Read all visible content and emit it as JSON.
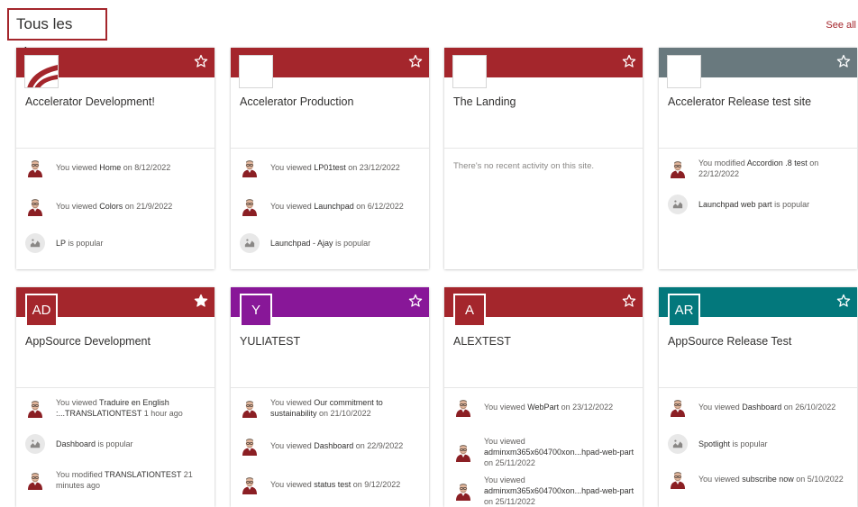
{
  "page": {
    "title": "Tous les sites",
    "see_all": "See all"
  },
  "colors": {
    "red": "#a4262c",
    "grey": "#69797e",
    "purple": "#881798",
    "teal": "#03787c",
    "link": "#a4262c"
  },
  "cards": [
    {
      "name": "Accelerator Development!",
      "banner": "#a4262c",
      "logo": "acr-logo-icon",
      "favorite": false,
      "activities": [
        {
          "type": "viewed",
          "prefix": "You viewed ",
          "bold": "Home",
          "suffix": " on 8/12/2022"
        },
        {
          "type": "viewed",
          "prefix": "You viewed ",
          "bold": "Colors",
          "suffix": " on 21/9/2022"
        },
        {
          "type": "popular",
          "prefix": "",
          "bold": "LP",
          "suffix": " is popular"
        }
      ]
    },
    {
      "name": "Accelerator Production",
      "banner": "#a4262c",
      "logo": "blank",
      "favorite": false,
      "activities": [
        {
          "type": "viewed",
          "prefix": "You viewed ",
          "bold": "LP01test",
          "suffix": " on 23/12/2022"
        },
        {
          "type": "viewed",
          "prefix": "You viewed ",
          "bold": "Launchpad",
          "suffix": " on 6/12/2022"
        },
        {
          "type": "popular",
          "prefix": "",
          "bold": "Launchpad - Ajay",
          "suffix": " is popular"
        }
      ]
    },
    {
      "name": "The Landing",
      "banner": "#a4262c",
      "logo": "blank",
      "favorite": false,
      "empty_message": "There's no recent activity on this site.",
      "activities": []
    },
    {
      "name": "Accelerator Release test site",
      "banner": "#69797e",
      "logo": "blank",
      "favorite": false,
      "activities": [
        {
          "type": "viewed",
          "prefix": "You modified ",
          "bold": "Accordion .8 test",
          "suffix": " on 22/12/2022"
        },
        {
          "type": "popular",
          "prefix": "",
          "bold": "Launchpad web part",
          "suffix": " is popular"
        }
      ]
    },
    {
      "name": "AppSource Development",
      "banner": "#a4262c",
      "logo": "initials",
      "initials": "AD",
      "favorite": true,
      "activities": [
        {
          "type": "viewed",
          "prefix": "You viewed ",
          "bold": "Traduire en English :...TRANSLATIONTEST",
          "suffix": " 1 hour ago"
        },
        {
          "type": "popular",
          "prefix": "",
          "bold": "Dashboard",
          "suffix": " is popular"
        },
        {
          "type": "viewed",
          "prefix": "You modified ",
          "bold": "TRANSLATIONTEST",
          "suffix": " 21 minutes ago"
        }
      ]
    },
    {
      "name": "YULIATEST",
      "banner": "#881798",
      "logo": "initials",
      "initials": "Y",
      "favorite": false,
      "activities": [
        {
          "type": "viewed",
          "prefix": "You viewed ",
          "bold": "Our commitment to sustainability",
          "suffix": " on 21/10/2022"
        },
        {
          "type": "viewed",
          "prefix": "You viewed ",
          "bold": "Dashboard",
          "suffix": " on 22/9/2022"
        },
        {
          "type": "viewed",
          "prefix": "You viewed ",
          "bold": "status test",
          "suffix": " on 9/12/2022"
        }
      ]
    },
    {
      "name": "ALEXTEST",
      "banner": "#a4262c",
      "logo": "initials",
      "initials": "A",
      "favorite": false,
      "activities": [
        {
          "type": "viewed",
          "prefix": "You viewed ",
          "bold": "WebPart",
          "suffix": " on 23/12/2022"
        },
        {
          "type": "viewed",
          "prefix": "You viewed ",
          "bold": "adminxm365x604700xon...hpad-web-part",
          "suffix": " on 25/11/2022"
        },
        {
          "type": "viewed",
          "prefix": "You viewed ",
          "bold": "adminxm365x604700xon...hpad-web-part",
          "suffix": " on 25/11/2022"
        }
      ]
    },
    {
      "name": "AppSource Release Test",
      "banner": "#03787c",
      "logo": "initials",
      "initials": "AR",
      "favorite": false,
      "activities": [
        {
          "type": "viewed",
          "prefix": "You viewed ",
          "bold": "Dashboard",
          "suffix": " on 26/10/2022"
        },
        {
          "type": "popular",
          "prefix": "",
          "bold": "Spotlight",
          "suffix": " is popular"
        },
        {
          "type": "viewed",
          "prefix": "You viewed ",
          "bold": "subscribe now",
          "suffix": " on 5/10/2022"
        }
      ]
    }
  ]
}
